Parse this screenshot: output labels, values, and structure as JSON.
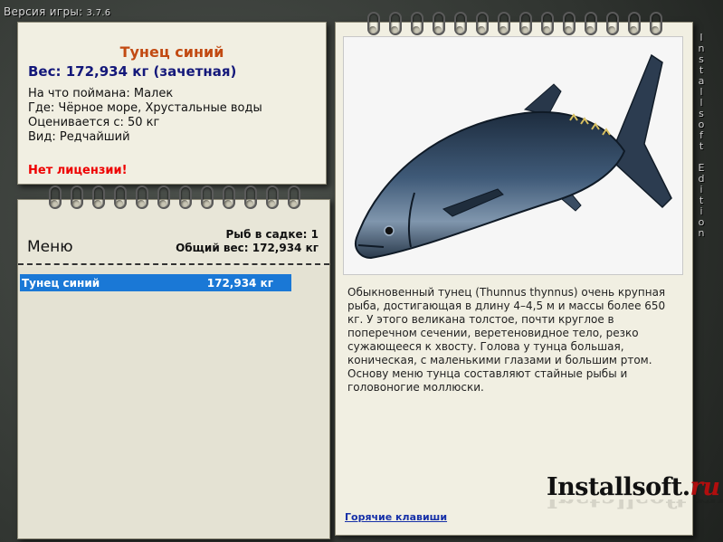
{
  "version": {
    "label": "Версия игры:",
    "number": "3.7.6"
  },
  "fish": {
    "name": "Тунец синий",
    "weight_line": "Вес: 172,934 кг (зачетная)",
    "details": [
      "На что поймана: Малек",
      "Где: Чёрное море, Хрустальные воды",
      "Оценивается с: 50 кг",
      "Вид: Редчайший"
    ],
    "license": "Нет лицензии!"
  },
  "list": {
    "menu_label": "Меню",
    "count_line": "Рыб в садке: 1",
    "total_line": "Общий вес: 172,934 кг",
    "rows": [
      {
        "name": "Тунец синий",
        "weight": "172,934 кг"
      }
    ]
  },
  "description": "Обыкновенный тунец (Thunnus thynnus) очень крупная рыба, достигающая в длину 4–4,5 м и массы более 650 кг. У этого великана толстое, почти круглое в поперечном сечении, веретеновидное тело, резко сужающееся к хвосту. Голова у тунца большая, коническая, с маленькими глазами и большим ртом. Основу меню тунца составляют стайные рыбы и головоногие моллюски.",
  "hotkeys_label": "Горячие клавиши",
  "logo": {
    "main": "Installsoft.",
    "suffix": "ru"
  },
  "edition_vertical": "Installsoft Edition",
  "colors": {
    "title_orange": "#c24a12",
    "weight_blue": "#14187a",
    "selection_blue": "#1a78d6",
    "warning_red": "#e00000"
  }
}
